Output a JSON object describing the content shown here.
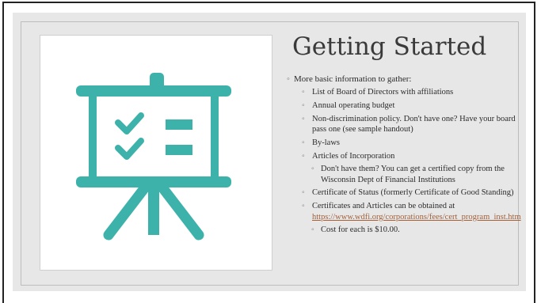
{
  "slide": {
    "title": "Getting Started",
    "bullet_glyph": "◦",
    "bullets": [
      {
        "level": 1,
        "text": "More basic information to gather:"
      },
      {
        "level": 2,
        "text": "List of Board of Directors with affiliations"
      },
      {
        "level": 2,
        "text": "Annual operating budget"
      },
      {
        "level": 2,
        "text": "Non-discrimination policy. Don't have one? Have your board pass one (see sample handout)"
      },
      {
        "level": 2,
        "text": "By-laws"
      },
      {
        "level": 2,
        "text": "Articles of Incorporation"
      },
      {
        "level": 3,
        "text": "Don't have them? You can get a certified copy from the Wisconsin Dept of Financial Institutions"
      },
      {
        "level": 2,
        "text": "Certificate of Status (formerly Certificate of Good Standing)"
      },
      {
        "level": 2,
        "text": "Certificates and Articles can be obtained at"
      },
      {
        "level": 3,
        "text": "Cost for each is $10.00."
      }
    ],
    "link": {
      "text": "https://www.wdfi.org/corporations/fees/cert_program_inst.htm",
      "color": "#a3613a"
    },
    "icon": {
      "name": "presentation-board-checklist-icon",
      "color": "#3cb2ab"
    }
  }
}
